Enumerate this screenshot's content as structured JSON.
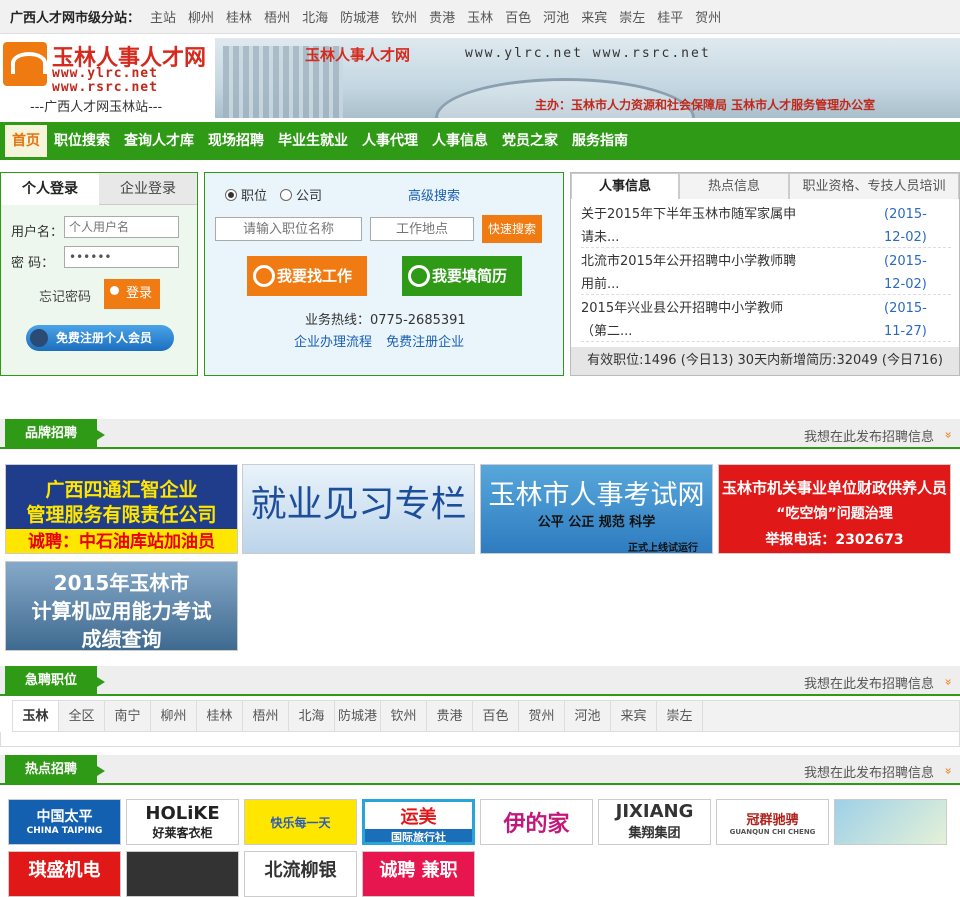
{
  "topbar": {
    "label": "广西人才网市级分站：",
    "cities": [
      "主站",
      "柳州",
      "桂林",
      "梧州",
      "北海",
      "防城港",
      "钦州",
      "贵港",
      "玉林",
      "百色",
      "河池",
      "来宾",
      "崇左",
      "桂平",
      "贺州"
    ]
  },
  "logo": {
    "title": "玉林人事人才网",
    "url1": "www.ylrc.net",
    "url2": "www.rsrc.net",
    "subtitle": "---广西人才网玉林站---"
  },
  "banner": {
    "title": "玉林人事人才网",
    "urls": "www.ylrc.net   www.rsrc.net",
    "sponsor": "主办：玉林市人力资源和社会保障局  玉林市人才服务管理办公室"
  },
  "nav": {
    "items": [
      "首页",
      "职位搜索",
      "查询人才库",
      "现场招聘",
      "毕业生就业",
      "人事代理",
      "人事信息",
      "党员之家",
      "服务指南"
    ]
  },
  "login": {
    "tab_personal": "个人登录",
    "tab_company": "企业登录",
    "username_label": "用户名：",
    "username_placeholder": "个人用户名",
    "password_label": "密  码：",
    "password_value": "••••••",
    "forgot": "忘记密码",
    "login_button": "登录",
    "register_button": "免费注册个人会员"
  },
  "search": {
    "radio_job": "职位",
    "radio_company": "公司",
    "advanced": "高级搜索",
    "job_placeholder": "请输入职位名称",
    "location_placeholder": "工作地点",
    "quick_button": "快速搜索",
    "find_job": "我要找工作",
    "fill_resume": "我要填简历",
    "hotline": "业务热线：0775-2685391",
    "link1": "企业办理流程",
    "link2": "免费注册企业"
  },
  "news": {
    "tabs": [
      "人事信息",
      "热点信息",
      "职业资格、专技人员培训"
    ],
    "items": [
      {
        "title": "关于2015年下半年玉林市随军家属申请未...",
        "date": "(2015-12-02)"
      },
      {
        "title": "北流市2015年公开招聘中小学教师聘用前...",
        "date": "(2015-12-02)"
      },
      {
        "title": "2015年兴业县公开招聘中小学教师（第二...",
        "date": "(2015-11-27)"
      }
    ],
    "stats": "有效职位:1496 (今日13) 30天内新增简历:32049 (今日716)"
  },
  "sections": {
    "brand": "品牌招聘",
    "urgent": "急聘职位",
    "hot": "热点招聘",
    "post_link": "我想在此发布招聘信息"
  },
  "brand_ads": [
    {
      "line1": "广西四通汇智企业",
      "line2": "管理服务有限责任公司",
      "line3": "诚聘：中石油库站加油员"
    },
    {
      "line1": "就业见习专栏"
    },
    {
      "line1": "玉林市人事考试网",
      "line2": "公平 公正 规范 科学",
      "line3": "正式上线试运行"
    },
    {
      "line1": "玉林市机关事业单位财政供养人员",
      "line2": "“吃空饷”问题治理",
      "line3": "举报电话：2302673"
    },
    {
      "line1": "2015年玉林市",
      "line2": "计算机应用能力考试",
      "line3": "成绩查询"
    }
  ],
  "urgent_cities": [
    "玉林",
    "全区",
    "南宁",
    "柳州",
    "桂林",
    "梧州",
    "北海",
    "防城港",
    "钦州",
    "贵港",
    "百色",
    "贺州",
    "河池",
    "来宾",
    "崇左"
  ],
  "hot_logos": [
    {
      "text": "中国太平",
      "sub": "CHINA TAIPING"
    },
    {
      "text": "HOLiKE",
      "sub": "好莱客衣柜"
    },
    {
      "text": "快乐每一天",
      "sub": ""
    },
    {
      "text": "运美",
      "sub": "国际旅行社"
    },
    {
      "text": "伊的家",
      "sub": ""
    },
    {
      "text": "JIXIANG",
      "sub": "集翔集团"
    },
    {
      "text": "冠群驰骋",
      "sub": "GUANQUN CHI CHENG"
    },
    {
      "text": "",
      "sub": ""
    },
    {
      "text": "琪盛机电",
      "sub": ""
    },
    {
      "text": "",
      "sub": ""
    },
    {
      "text": "北流柳银",
      "sub": ""
    },
    {
      "text": "诚聘 兼职",
      "sub": ""
    }
  ],
  "colors": {
    "green": "#2e9a15",
    "orange": "#f07b12",
    "link": "#1a5fb4"
  }
}
